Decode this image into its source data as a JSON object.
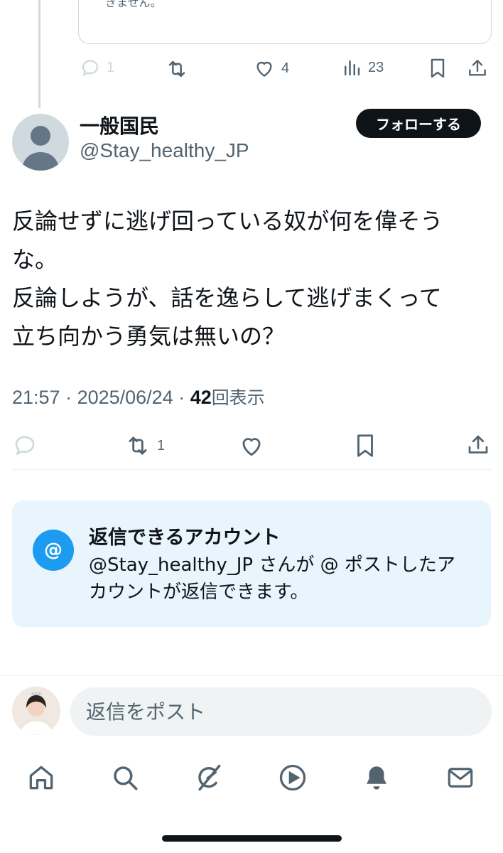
{
  "previous_post": {
    "quote_text": "きません。",
    "actions": {
      "reply_count": "1",
      "repost_count": "",
      "like_count": "4",
      "views_count": "23"
    }
  },
  "post": {
    "author": {
      "display_name": "一般国民",
      "handle": "@Stay_healthy_JP"
    },
    "follow_label": "フォローする",
    "text": "反論せずに逃げ回っている奴が何を偉そう\nな。\n反論しようが、話を逸らして逃げまくって\n立ち向かう勇気は無いの？",
    "time": "21:57",
    "date": "2025/06/24",
    "views_count": "42",
    "views_label": "回表示",
    "actions": {
      "repost_count": "1"
    }
  },
  "reply_restriction": {
    "icon_text": "@",
    "title": "返信できるアカウント",
    "text": "@Stay_healthy_JP さんが @ ポストしたアカウントが返信できます。"
  },
  "composer": {
    "placeholder": "返信をポスト"
  },
  "nav": {
    "items": [
      "home-icon",
      "search-icon",
      "grok-icon",
      "video-icon",
      "notifications-icon",
      "messages-icon"
    ]
  },
  "colors": {
    "accent": "#1d9bf0",
    "secondary_text": "#536471",
    "restrict_bg": "#e8f5fd"
  }
}
